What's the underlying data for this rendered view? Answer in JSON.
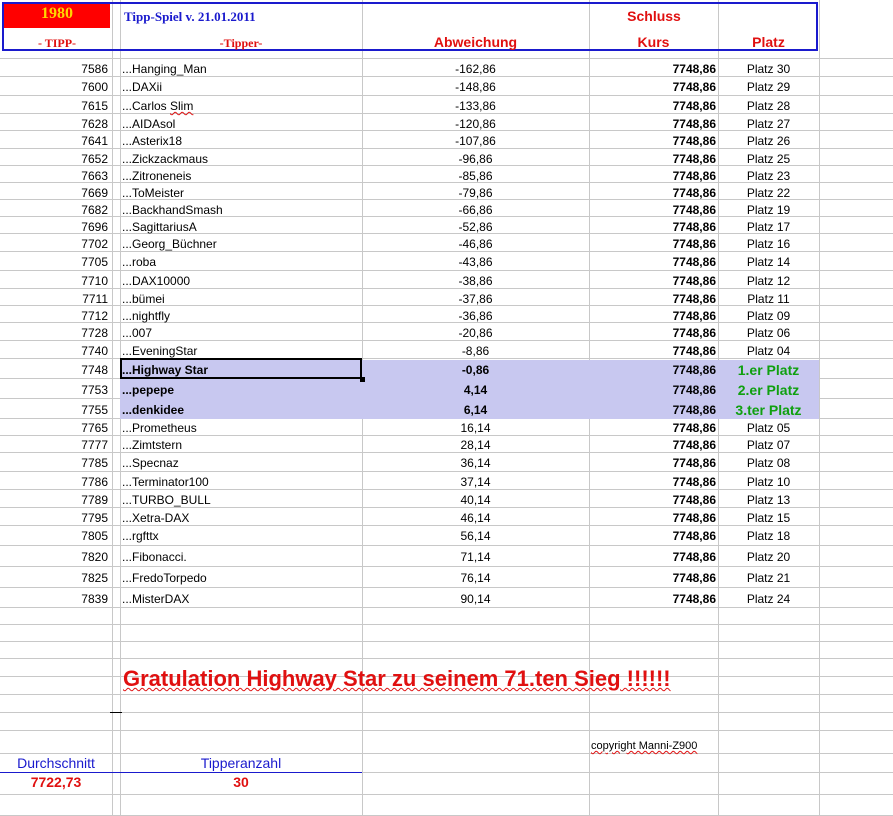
{
  "header": {
    "year": "1980",
    "title": "Tipp-Spiel v. 21.01.2011",
    "schluss": "Schluss",
    "col_tipp": "- TIPP-",
    "col_tipper": "-Tipper-",
    "col_abweichung": "Abweichung",
    "col_kurs": "Kurs",
    "col_platz": "Platz"
  },
  "rows": [
    {
      "tipp": "7586",
      "name": "...Hanging_Man",
      "abw": "-162,86",
      "kurs": "7748,86",
      "platz": "Platz 30"
    },
    {
      "tipp": "7600",
      "name": "...DAXii",
      "abw": "-148,86",
      "kurs": "7748,86",
      "platz": "Platz 29"
    },
    {
      "tipp": "7615",
      "name": "...Carlos Slim",
      "abw": "-133,86",
      "kurs": "7748,86",
      "platz": "Platz 28"
    },
    {
      "tipp": "7628",
      "name": "...AIDAsol",
      "abw": "-120,86",
      "kurs": "7748,86",
      "platz": "Platz 27"
    },
    {
      "tipp": "7641",
      "name": "...Asterix18",
      "abw": "-107,86",
      "kurs": "7748,86",
      "platz": "Platz 26"
    },
    {
      "tipp": "7652",
      "name": "...Zickzackmaus",
      "abw": "-96,86",
      "kurs": "7748,86",
      "platz": "Platz 25"
    },
    {
      "tipp": "7663",
      "name": "...Zitroneneis",
      "abw": "-85,86",
      "kurs": "7748,86",
      "platz": "Platz 23"
    },
    {
      "tipp": "7669",
      "name": "...ToMeister",
      "abw": "-79,86",
      "kurs": "7748,86",
      "platz": "Platz 22"
    },
    {
      "tipp": "7682",
      "name": "...BackhandSmash",
      "abw": "-66,86",
      "kurs": "7748,86",
      "platz": "Platz 19"
    },
    {
      "tipp": "7696",
      "name": "...SagittariusA",
      "abw": "-52,86",
      "kurs": "7748,86",
      "platz": "Platz 17"
    },
    {
      "tipp": "7702",
      "name": "...Georg_Büchner",
      "abw": "-46,86",
      "kurs": "7748,86",
      "platz": "Platz 16"
    },
    {
      "tipp": "7705",
      "name": "...roba",
      "abw": "-43,86",
      "kurs": "7748,86",
      "platz": "Platz 14"
    },
    {
      "tipp": "7710",
      "name": "...DAX10000",
      "abw": "-38,86",
      "kurs": "7748,86",
      "platz": "Platz 12"
    },
    {
      "tipp": "7711",
      "name": "...bümei",
      "abw": "-37,86",
      "kurs": "7748,86",
      "platz": "Platz 11"
    },
    {
      "tipp": "7712",
      "name": "...nightfly",
      "abw": "-36,86",
      "kurs": "7748,86",
      "platz": "Platz 09"
    },
    {
      "tipp": "7728",
      "name": "...007",
      "abw": "-20,86",
      "kurs": "7748,86",
      "platz": "Platz 06"
    },
    {
      "tipp": "7740",
      "name": "...EveningStar",
      "abw": "-8,86",
      "kurs": "7748,86",
      "platz": "Platz 04"
    },
    {
      "tipp": "7748",
      "name": "...Highway Star",
      "abw": "-0,86",
      "kurs": "7748,86",
      "platz": "1.er Platz",
      "winner": true
    },
    {
      "tipp": "7753",
      "name": "...pepepe",
      "abw": "4,14",
      "kurs": "7748,86",
      "platz": "2.er Platz",
      "winner": true
    },
    {
      "tipp": "7755",
      "name": "...denkidee",
      "abw": "6,14",
      "kurs": "7748,86",
      "platz": "3.ter Platz",
      "winner": true
    },
    {
      "tipp": "7765",
      "name": "...Prometheus",
      "abw": "16,14",
      "kurs": "7748,86",
      "platz": "Platz 05"
    },
    {
      "tipp": "7777",
      "name": "...Zimtstern",
      "abw": "28,14",
      "kurs": "7748,86",
      "platz": "Platz 07"
    },
    {
      "tipp": "7785",
      "name": "...Specnaz",
      "abw": "36,14",
      "kurs": "7748,86",
      "platz": "Platz 08"
    },
    {
      "tipp": "7786",
      "name": "...Terminator100",
      "abw": "37,14",
      "kurs": "7748,86",
      "platz": "Platz 10"
    },
    {
      "tipp": "7789",
      "name": "...TURBO_BULL",
      "abw": "40,14",
      "kurs": "7748,86",
      "platz": "Platz 13"
    },
    {
      "tipp": "7795",
      "name": "...Xetra-DAX",
      "abw": "46,14",
      "kurs": "7748,86",
      "platz": "Platz 15"
    },
    {
      "tipp": "7805",
      "name": "...rgfttx",
      "abw": "56,14",
      "kurs": "7748,86",
      "platz": "Platz 18"
    },
    {
      "tipp": "7820",
      "name": "...Fibonacci.",
      "abw": "71,14",
      "kurs": "7748,86",
      "platz": "Platz 20"
    },
    {
      "tipp": "7825",
      "name": "...FredoTorpedo",
      "abw": "76,14",
      "kurs": "7748,86",
      "platz": "Platz 21"
    },
    {
      "tipp": "7839",
      "name": "...MisterDAX",
      "abw": "90,14",
      "kurs": "7748,86",
      "platz": "Platz 24"
    }
  ],
  "footer": {
    "congrats": "Gratulation Highway Star  zu seinem 71.ten Sieg !!!!!!",
    "copyright": "copyright Manni-Z900",
    "durchschnitt_label": "Durchschnitt",
    "durchschnitt_value": "7722,73",
    "tipperanzahl_label": "Tipperanzahl",
    "tipperanzahl_value": "30"
  },
  "colors": {
    "accent_blue": "#1a1acd",
    "red": "#e01010",
    "green": "#10a010",
    "highlight": "#c8c8f0"
  }
}
